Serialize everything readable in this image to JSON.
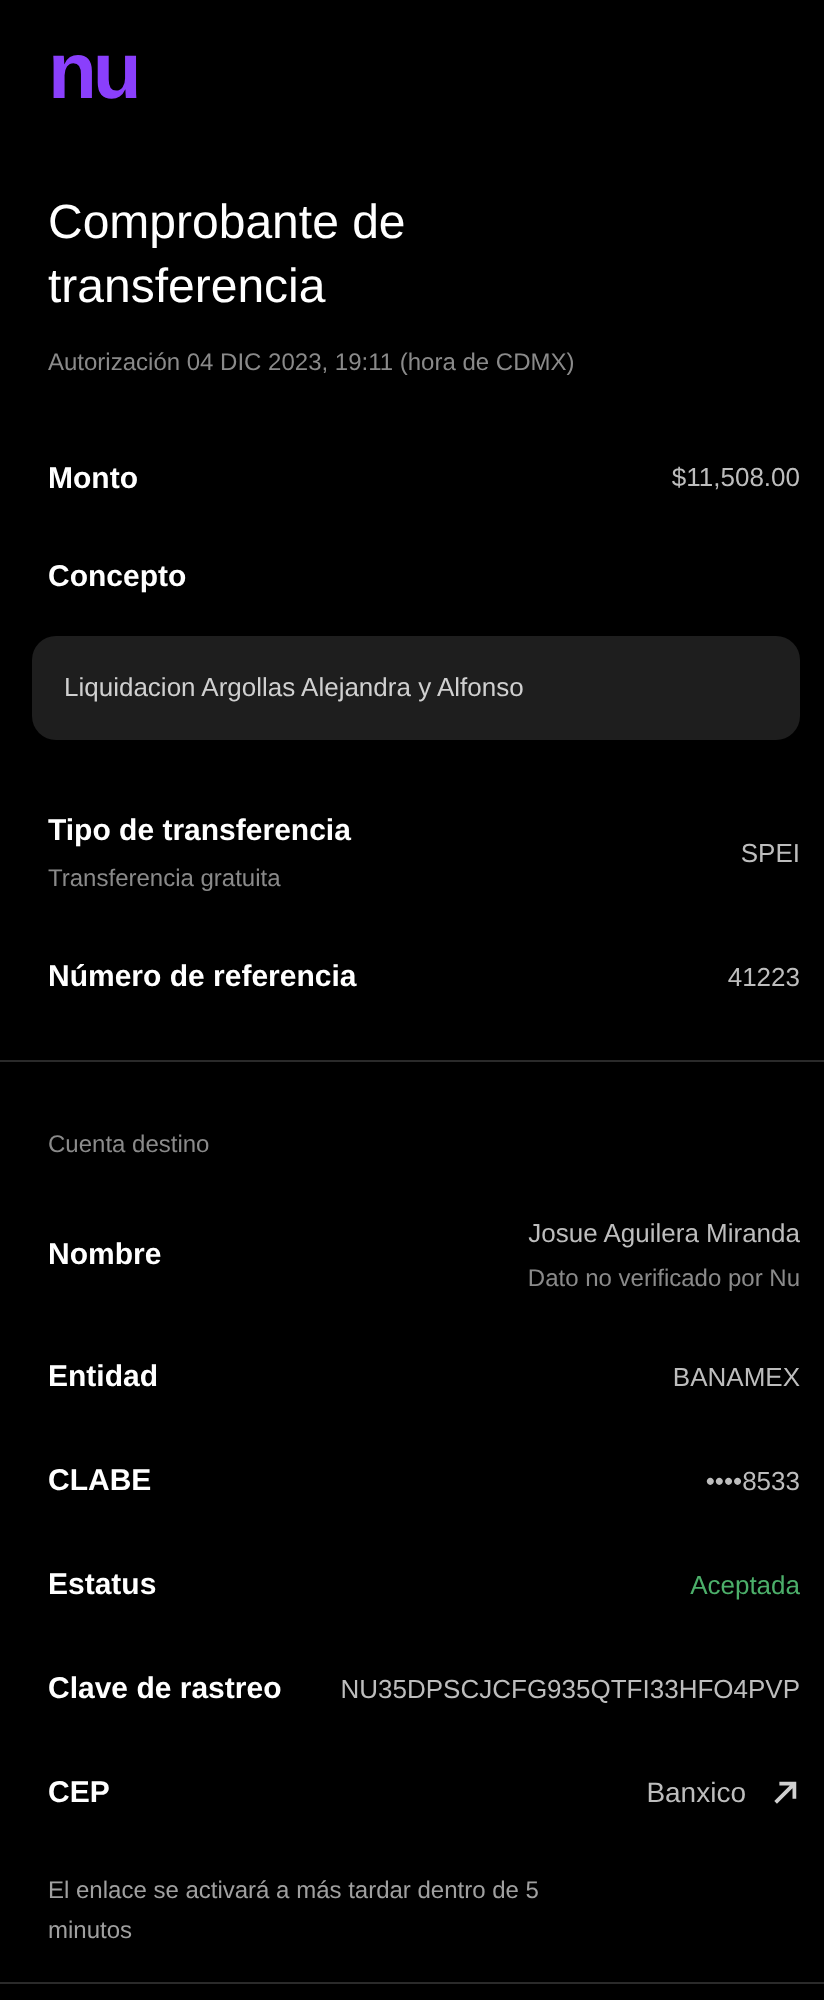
{
  "logo": "nu",
  "title": "Comprobante de transferencia",
  "subtitle": "Autorización 04 DIC 2023, 19:11 (hora de CDMX)",
  "details": [
    {
      "label": "Monto",
      "value": "$11,508.00",
      "kind": "text"
    }
  ],
  "concept": {
    "label": "Concepto",
    "value": "Liquidacion Argollas Alejandra y Alfonso"
  },
  "transfer": [
    {
      "label": "Tipo de transferencia",
      "sublabel": "Transferencia gratuita",
      "value": "SPEI",
      "kind": "text"
    },
    {
      "label": "Número de referencia",
      "value": "41223",
      "kind": "text"
    }
  ],
  "destination": {
    "heading": "Cuenta destino",
    "rows": [
      {
        "label": "Nombre",
        "value": "Josue Aguilera Miranda",
        "note": "Dato no verificado por Nu",
        "kind": "text"
      },
      {
        "label": "Entidad",
        "value": "BANAMEX",
        "kind": "text"
      },
      {
        "label": "CLABE",
        "value": "••••8533",
        "kind": "text"
      },
      {
        "label": "Estatus",
        "value": "Aceptada",
        "kind": "status"
      },
      {
        "label": "Clave de rastreo",
        "value": "NU35DPSCJCFG935QTFI33HFO4PVP",
        "kind": "text"
      },
      {
        "label": "CEP",
        "value": "Banxico",
        "kind": "link"
      }
    ]
  },
  "footnote": "El enlace se activará a más tardar dentro de 5 minutos"
}
